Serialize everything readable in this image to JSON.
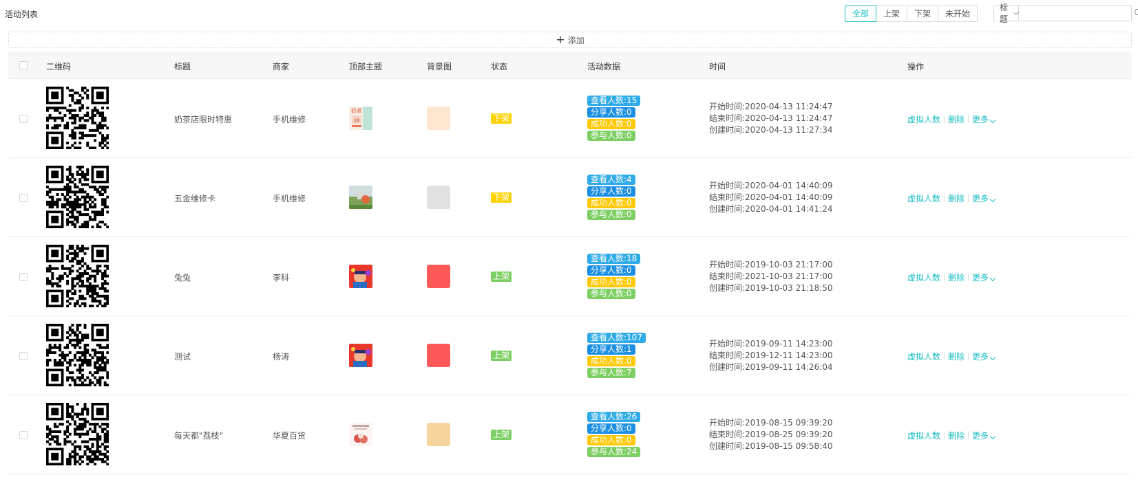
{
  "page_title": "活动列表",
  "filters": [
    "全部",
    "上架",
    "下架",
    "未开始"
  ],
  "active_filter": 0,
  "search": {
    "type_label": "标题",
    "value": ""
  },
  "add_label": "添加",
  "columns": [
    "二维码",
    "标题",
    "商家",
    "顶部主题",
    "背景图",
    "状态",
    "活动数据",
    "时间",
    "操作"
  ],
  "colors": {
    "accent": "#1bbfc5",
    "status_off": "#fcd202",
    "status_on": "#7dcf63",
    "stat_view": "#2fabe8",
    "stat_share": "#1a8fe3",
    "stat_success": "#ffc800",
    "stat_join": "#7dcf63"
  },
  "rows": [
    {
      "title": "奶茶店限时特惠",
      "merchant": "手机维修",
      "theme_icon": "milk-tea-promo-thumbnail",
      "bg_color": "#fde6cf",
      "status": "下架",
      "status_type": "off",
      "stats": [
        "查看人数:15",
        "分享人数:0",
        "成功人数:0",
        "参与人数:0"
      ],
      "times": [
        "开始时间:2020-04-13 11:24:47",
        "结束时间:2020-04-13 11:24:47",
        "创建时间:2020-04-13 11:27:34"
      ]
    },
    {
      "title": "五金维修卡",
      "merchant": "手机维修",
      "theme_icon": "landscape-photo-thumbnail",
      "bg_color": "#e1e1e1",
      "status": "下架",
      "status_type": "off",
      "stats": [
        "查看人数:4",
        "分享人数:0",
        "成功人数:0",
        "参与人数:0"
      ],
      "times": [
        "开始时间:2020-04-01 14:40:09",
        "结束时间:2020-04-01 14:40:09",
        "创建时间:2020-04-01 14:41:24"
      ]
    },
    {
      "title": "兔兔",
      "merchant": "李科",
      "theme_icon": "cartoon-red-thumbnail",
      "bg_color": "#fe5959",
      "status": "上架",
      "status_type": "on",
      "stats": [
        "查看人数:18",
        "分享人数:0",
        "成功人数:0",
        "参与人数:0"
      ],
      "times": [
        "开始时间:2019-10-03 21:17:00",
        "结束时间:2021-10-03 21:17:00",
        "创建时间:2019-10-03 21:18:50"
      ]
    },
    {
      "title": "测试",
      "merchant": "杨涛",
      "theme_icon": "cartoon-red-thumbnail",
      "bg_color": "#fe5959",
      "status": "上架",
      "status_type": "on",
      "stats": [
        "查看人数:107",
        "分享人数:1",
        "成功人数:0",
        "参与人数:7"
      ],
      "times": [
        "开始时间:2019-09-11 14:23:00",
        "结束时间:2019-12-11 14:23:00",
        "创建时间:2019-09-11 14:26:04"
      ]
    },
    {
      "title": "每天都\"荔枝\"",
      "merchant": "华夏百货",
      "theme_icon": "lychee-fruit-thumbnail",
      "bg_color": "#f6d49e",
      "status": "上架",
      "status_type": "on",
      "stats": [
        "查看人数:26",
        "分享人数:0",
        "成功人数:0",
        "参与人数:24"
      ],
      "times": [
        "开始时间:2019-08-15 09:39:20",
        "结束时间:2019-08-25 09:39:20",
        "创建时间:2019-08-15 09:58:40"
      ]
    }
  ],
  "actions": [
    "虚拟人数",
    "删除",
    "更多"
  ]
}
